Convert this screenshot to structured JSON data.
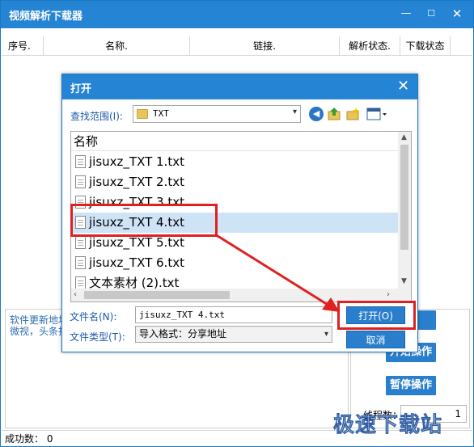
{
  "main": {
    "title": "视频解析下载器",
    "controls": {
      "min": "—",
      "max": "☐",
      "close": "✕"
    },
    "columns": [
      "序号.",
      "名称.",
      "链接.",
      "解析状态.",
      "下载状态"
    ],
    "notes": [
      "软件更新地址",
      "微视，头条抖"
    ],
    "buttons": [
      "址",
      "开始操作",
      "暂停操作"
    ],
    "threads_label": "线程数：",
    "threads_value": "1",
    "status_label": "成功数：",
    "status_value": "0"
  },
  "dialog": {
    "title": "打开",
    "close": "✕",
    "lookin_label": "查找范围(I):",
    "lookin_value": "TXT",
    "list_header": "名称",
    "files": [
      "jisuxz_TXT 1.txt",
      "jisuxz_TXT 2.txt",
      "jisuxz_TXT 3.txt",
      "jisuxz_TXT 4.txt",
      "jisuxz_TXT 5.txt",
      "jisuxz_TXT 6.txt",
      "文本素材 (2).txt"
    ],
    "selected_index": 3,
    "filename_label": "文件名(N):",
    "filename_value": "jisuxz_TXT 4.txt",
    "filetype_label": "文件类型(T):",
    "filetype_value": "导入格式：分享地址",
    "open_button": "打开(O)",
    "cancel_button": "取消"
  },
  "watermark": "极速下载站",
  "colors": {
    "titlebar": "#2684d4",
    "button": "#2a7fcd",
    "highlight": "#e02020",
    "label": "#1e58a8"
  }
}
